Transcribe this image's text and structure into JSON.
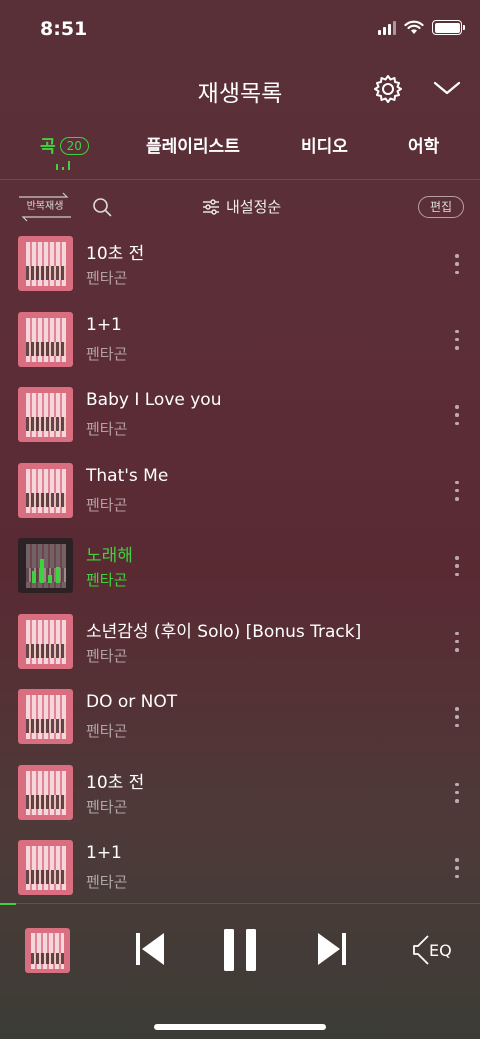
{
  "status_bar": {
    "time": "8:51"
  },
  "header": {
    "title": "재생목록"
  },
  "tabs": [
    {
      "label": "곡",
      "count": "20",
      "active": true
    },
    {
      "label": "플레이리스트"
    },
    {
      "label": "비디오"
    },
    {
      "label": "어학"
    }
  ],
  "toolbar": {
    "repeat_label": "반복재생",
    "sort_label": "내설정순",
    "edit_label": "편집"
  },
  "songs": [
    {
      "title": "10초 전",
      "artist": "펜타곤"
    },
    {
      "title": "1+1",
      "artist": "펜타곤"
    },
    {
      "title": "Baby I Love you",
      "artist": "펜타곤"
    },
    {
      "title": "That's Me",
      "artist": "펜타곤"
    },
    {
      "title": "노래해",
      "artist": "펜타곤",
      "now_playing": true
    },
    {
      "title": "소년감성 (후이 Solo) [Bonus Track]",
      "artist": "펜타곤"
    },
    {
      "title": "DO or NOT",
      "artist": "펜타곤"
    },
    {
      "title": "10초 전",
      "artist": "펜타곤"
    },
    {
      "title": "1+1",
      "artist": "펜타곤"
    }
  ],
  "player": {
    "eq_label": "EQ"
  },
  "colors": {
    "accent": "#3fd13f",
    "background": "#5a2e37"
  }
}
